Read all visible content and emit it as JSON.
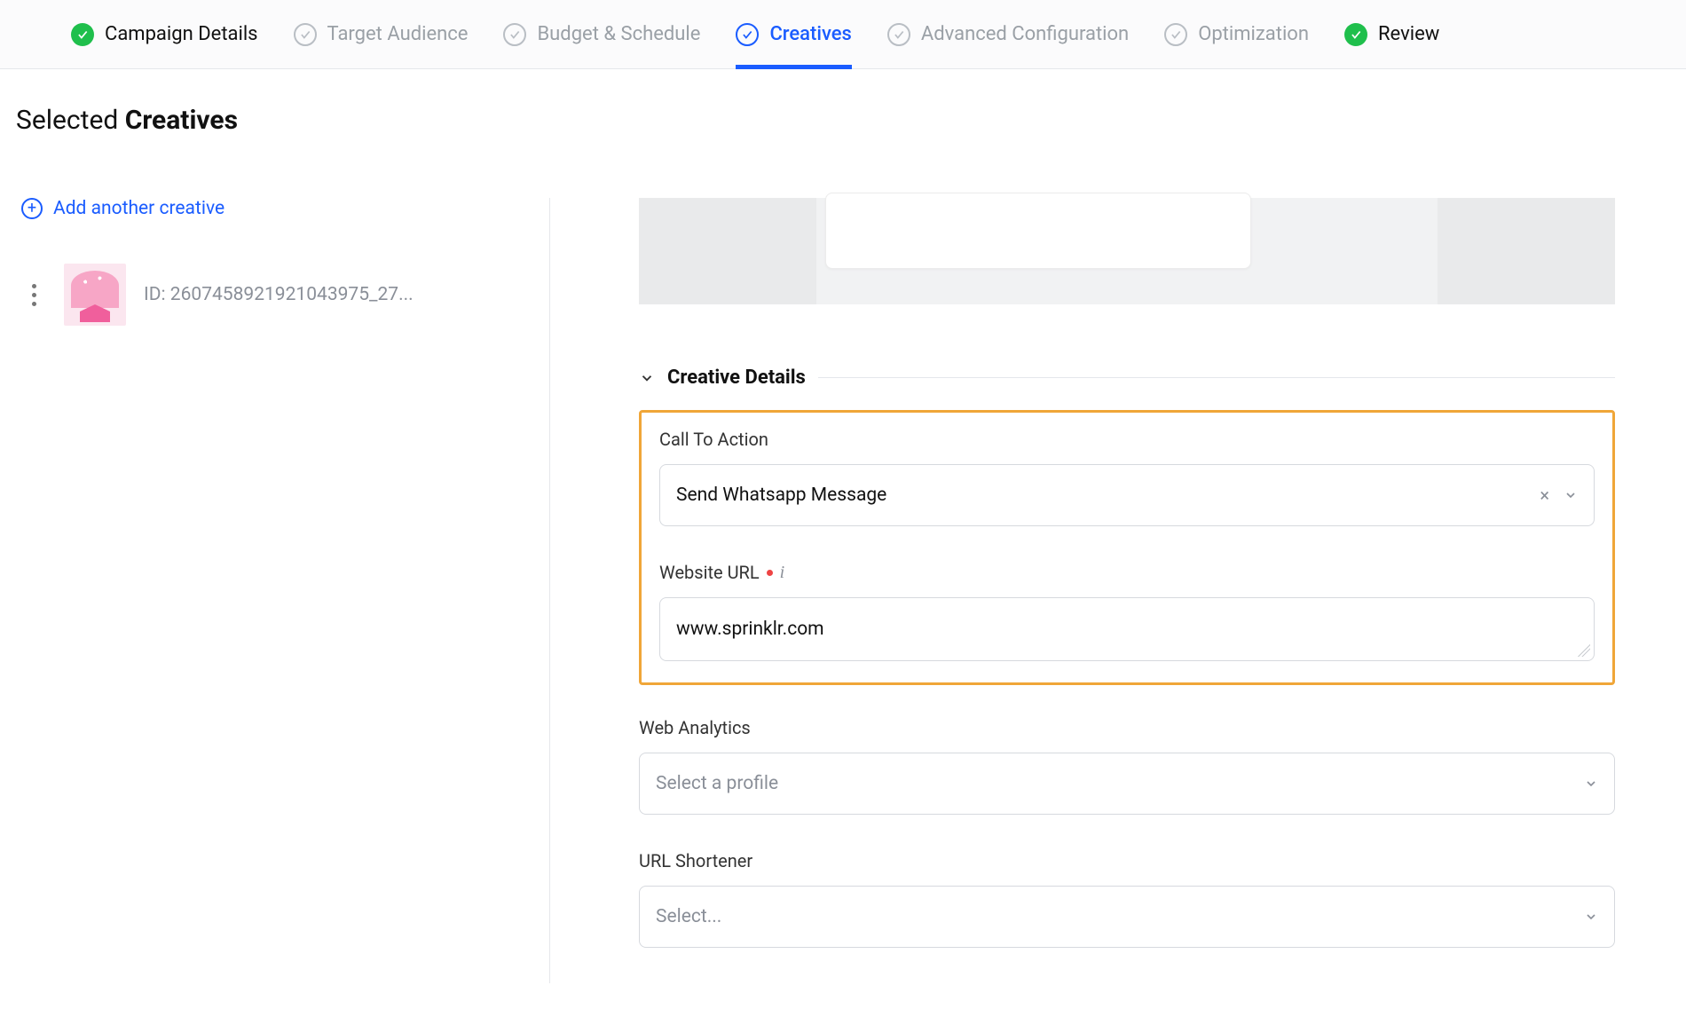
{
  "stepper": [
    {
      "label": "Campaign Details",
      "state": "complete"
    },
    {
      "label": "Target Audience",
      "state": "pending"
    },
    {
      "label": "Budget & Schedule",
      "state": "pending"
    },
    {
      "label": "Creatives",
      "state": "active"
    },
    {
      "label": "Advanced Configuration",
      "state": "pending"
    },
    {
      "label": "Optimization",
      "state": "pending"
    },
    {
      "label": "Review",
      "state": "complete"
    }
  ],
  "page_title": {
    "prefix": "Selected ",
    "bold": "Creatives"
  },
  "sidebar": {
    "add_label": "Add another creative",
    "item_id": "ID: 2607458921921043975_27..."
  },
  "section": {
    "title": "Creative Details",
    "cta": {
      "label": "Call To Action",
      "value": "Send Whatsapp Message"
    },
    "website_url": {
      "label": "Website URL",
      "value": "www.sprinklr.com"
    },
    "web_analytics": {
      "label": "Web Analytics",
      "placeholder": "Select a profile"
    },
    "url_shortener": {
      "label": "URL Shortener",
      "placeholder": "Select..."
    }
  }
}
